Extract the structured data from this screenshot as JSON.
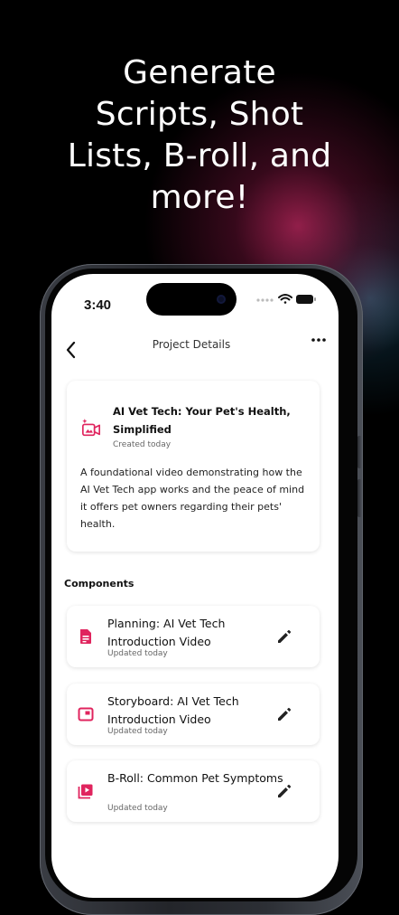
{
  "headline": {
    "lines": [
      "Generate",
      "Scripts, Shot",
      "Lists, B-roll, and",
      "more!"
    ]
  },
  "status_bar": {
    "time": "3:40",
    "icons": [
      "signal-dots-icon",
      "wifi-icon",
      "battery-icon"
    ]
  },
  "nav": {
    "back_icon": "chevron-left-icon",
    "title": "Project Details",
    "more_icon": "more-horizontal-icon"
  },
  "project": {
    "icon": "video-sparkle-icon",
    "title": "AI Vet Tech: Your Pet's Health, Simplified",
    "created": "Created today",
    "description": "A foundational video demonstrating how the AI Vet Tech app works and the peace of mind it offers pet owners regarding their pets' health."
  },
  "components": {
    "label": "Components",
    "items": [
      {
        "icon": "document-icon",
        "title": "Planning: AI Vet Tech Introduction Video",
        "updated": "Updated today",
        "edit_icon": "pencil-icon"
      },
      {
        "icon": "storyboard-icon",
        "title": "Storyboard: AI Vet Tech Introduction Video",
        "updated": "Updated today",
        "edit_icon": "pencil-icon"
      },
      {
        "icon": "video-library-icon",
        "title": "B-Roll: Common Pet Symptoms",
        "updated": "Updated today",
        "edit_icon": "pencil-icon"
      }
    ]
  },
  "colors": {
    "accent": "#E0245E",
    "background": "#000000",
    "card": "#FFFFFF"
  }
}
